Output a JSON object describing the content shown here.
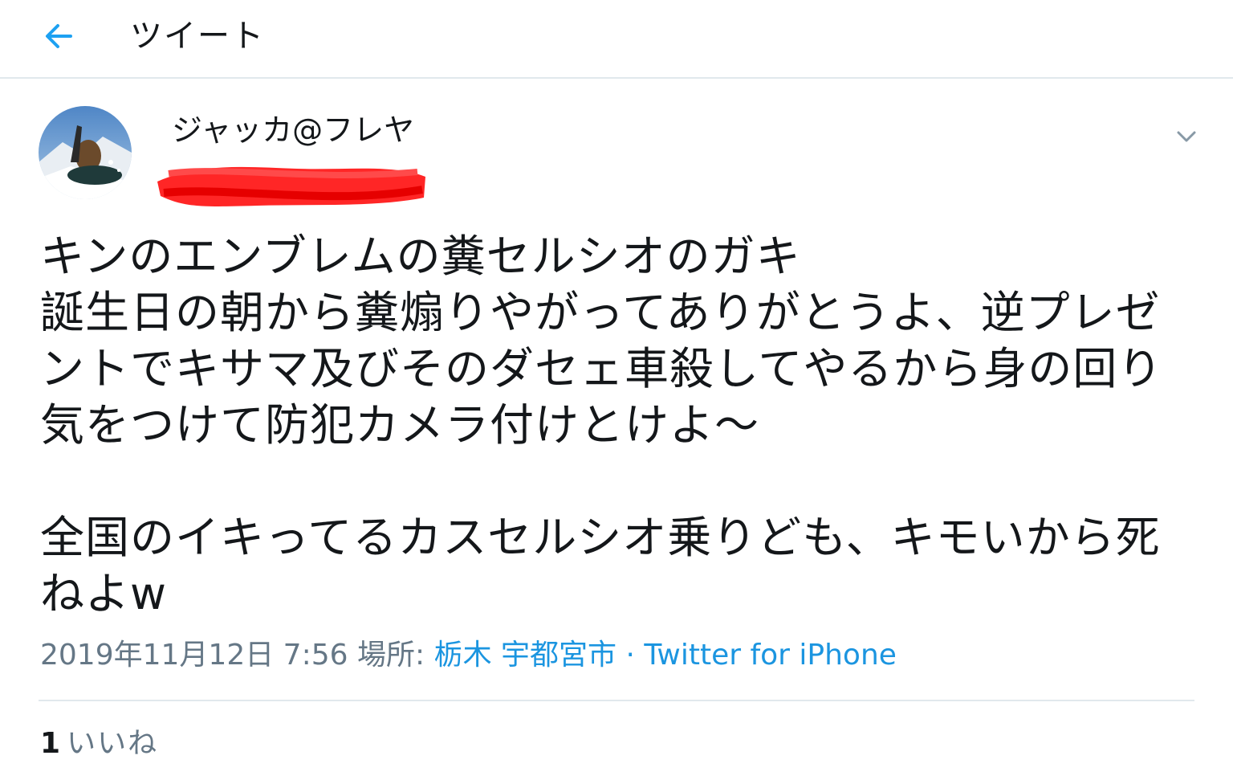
{
  "header": {
    "title": "ツイート",
    "back_icon": "arrow-left-icon",
    "accent_color": "#1da1f2"
  },
  "tweet": {
    "author": {
      "display_name": "ジャッカ@フレヤ",
      "avatar_icon": "profile-photo-snowboarder",
      "handle_redaction_color": "#ff1a1a"
    },
    "menu_icon": "chevron-down-icon",
    "text_paragraphs": [
      "キンのエンブレムの糞セルシオのガキ\n誕生日の朝から糞煽りやがってありがとうよ、逆プレゼントでキサマ及びそのダセェ車殺してやるから身の回り気をつけて防犯カメラ付けとけよ〜",
      "全国のイキってるカスセルシオ乗りども、キモいから死ねよw"
    ],
    "meta": {
      "timestamp": "2019年11月12日 7:56",
      "place_prefix": "場所: ",
      "place": "栃木 宇都宮市",
      "separator": " · ",
      "source": "Twitter for iPhone",
      "link_color": "#1b95e0"
    },
    "stats": {
      "likes_count": "1",
      "likes_label": "いいね"
    }
  }
}
